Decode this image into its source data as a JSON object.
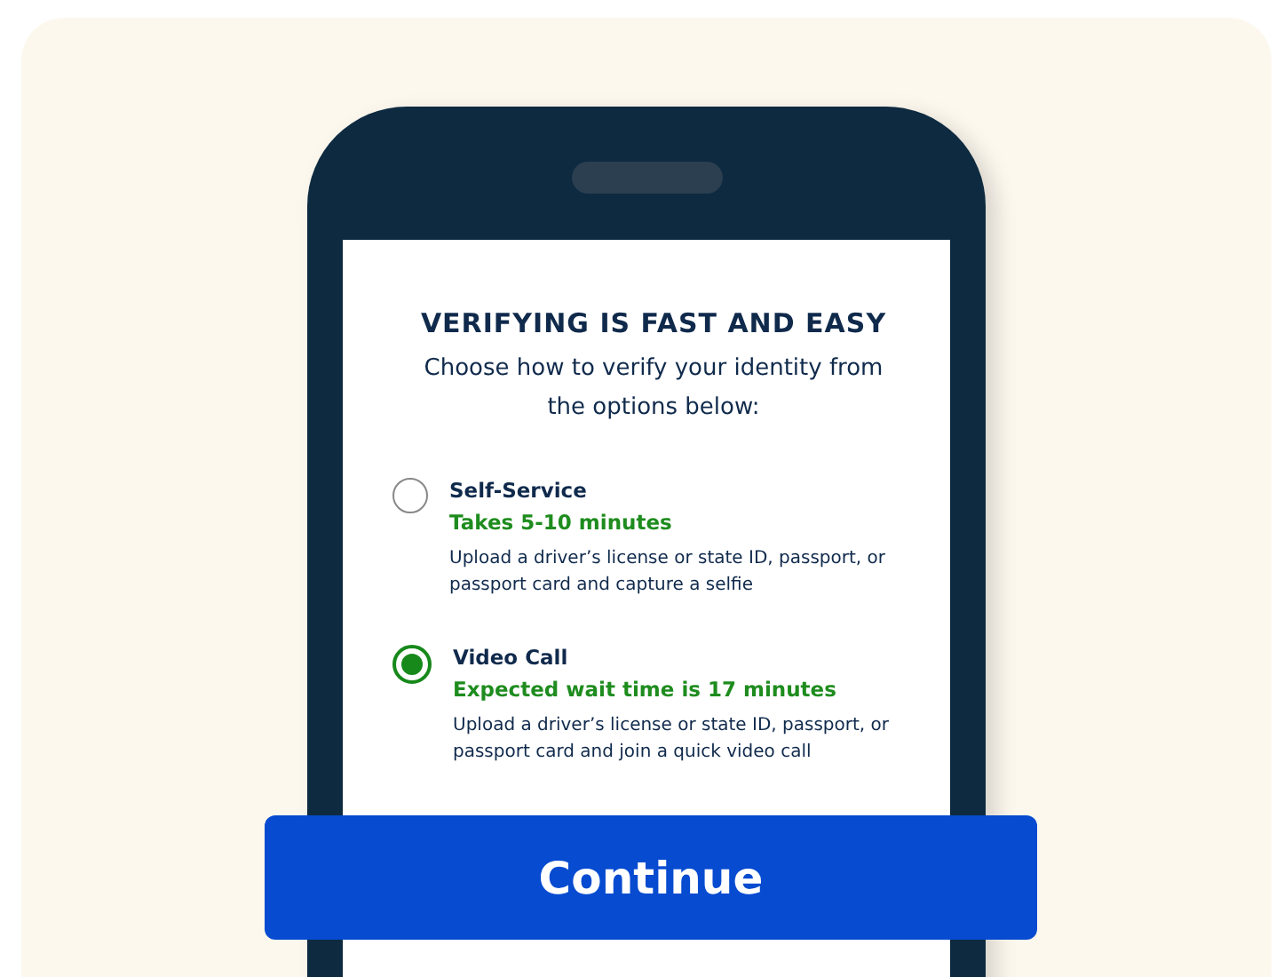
{
  "title": "VERIFYING IS FAST AND EASY",
  "subtitle": "Choose how to verify your identity from the options below:",
  "options": [
    {
      "name": "Self-Service",
      "time": "Takes 5-10 minutes",
      "description": "Upload a driver’s license or state ID, passport, or passport card and capture a selfie",
      "selected": false
    },
    {
      "name": "Video Call",
      "time": "Expected wait time is 17 minutes",
      "description": "Upload a driver’s license or state ID, passport, or passport card and join a quick video call",
      "selected": true
    }
  ],
  "button": "Continue"
}
